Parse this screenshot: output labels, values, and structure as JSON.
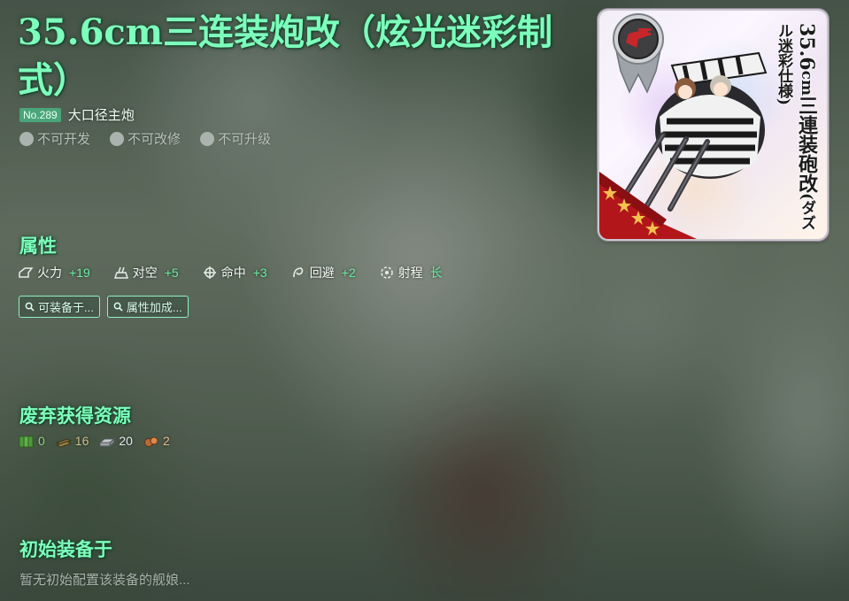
{
  "item": {
    "name": "35.6cm三连装炮改（炫光迷彩制式）",
    "number": "No.289",
    "type": "大口径主炮",
    "flags": [
      "不可开发",
      "不可改修",
      "不可升级"
    ]
  },
  "sections": {
    "stats_title": "属性",
    "scrap_title": "废弃获得资源",
    "initial_title": "初始装备于"
  },
  "stats": [
    {
      "icon": "firepower-icon",
      "label": "火力",
      "value": "+19"
    },
    {
      "icon": "anti-air-icon",
      "label": "对空",
      "value": "+5"
    },
    {
      "icon": "accuracy-icon",
      "label": "命中",
      "value": "+3"
    },
    {
      "icon": "evasion-icon",
      "label": "回避",
      "value": "+2"
    },
    {
      "icon": "range-icon",
      "label": "射程",
      "value": "长"
    }
  ],
  "buttons": {
    "equippable": "可装备于...",
    "bonus": "属性加成..."
  },
  "resources": [
    {
      "icon": "fuel-icon",
      "value": "0",
      "color": "#8fd47a"
    },
    {
      "icon": "ammo-icon",
      "value": "16",
      "color": "#c9c08a"
    },
    {
      "icon": "steel-icon",
      "value": "20",
      "color": "#e6e9ec"
    },
    {
      "icon": "bauxite-icon",
      "value": "2",
      "color": "#e6b98a"
    }
  ],
  "initial_equip_text": "暂无初始配置该装备的舰娘...",
  "card": {
    "name_line1": "35.6",
    "name_line2": "cm",
    "name_line3": "三連装砲改",
    "name_line4": "(ダズル迷彩仕様)"
  },
  "colors": {
    "accent": "#7dffbc",
    "stat_value": "#69f0a4"
  }
}
